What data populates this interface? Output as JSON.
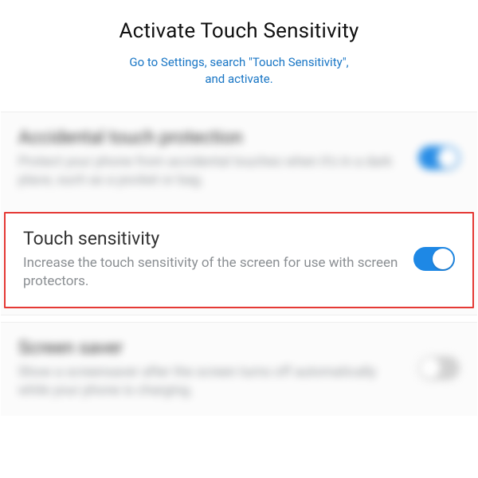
{
  "header": {
    "title": "Activate Touch Sensitivity",
    "subtitle_line1": "Go to Settings, search \"Touch Sensitivity\",",
    "subtitle_line2": "and activate."
  },
  "settings": {
    "items": [
      {
        "title": "Accidental touch protection",
        "desc": "Protect your phone from accidental touches when it's in a dark place, such as a pocket or bag.",
        "toggle_on": true
      },
      {
        "title": "Touch sensitivity",
        "desc": "Increase the touch sensitivity of the screen for use with screen protectors.",
        "toggle_on": true
      },
      {
        "title": "Screen saver",
        "desc": "Show a screensaver after the screen turns off automatically while your phone is charging.",
        "toggle_on": false
      }
    ]
  }
}
